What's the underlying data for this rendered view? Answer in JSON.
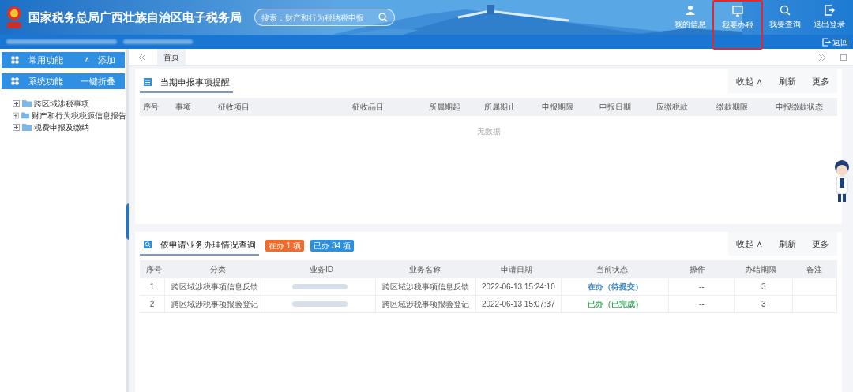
{
  "header": {
    "title": "国家税务总局广西壮族自治区电子税务局",
    "search": {
      "placeholder": "搜索：财产和行为税纳税申报"
    },
    "nav": [
      {
        "label": "我的信息",
        "selected": false
      },
      {
        "label": "我要办税",
        "selected": true
      },
      {
        "label": "我要查询",
        "selected": false
      },
      {
        "label": "退出登录",
        "selected": false
      }
    ]
  },
  "subbar": {
    "back": "返回"
  },
  "sidebar": {
    "sections": [
      {
        "title": "常用功能",
        "caret": "∧",
        "action": "添加"
      },
      {
        "title": "系统功能",
        "action": "一键折叠"
      }
    ],
    "tree": [
      {
        "label": "跨区域涉税事项",
        "expanded": false
      },
      {
        "label": "财产和行为税税源信息报告",
        "expanded": false
      },
      {
        "label": "税费申报及缴纳",
        "expanded": false
      }
    ]
  },
  "tabs": [
    {
      "label": "首页",
      "selected": true
    }
  ],
  "panels": [
    {
      "title": "当期申报事项提醒",
      "actions": [
        "收起 ∧",
        "刷新",
        "更多"
      ],
      "columns": [
        "序号",
        "事项",
        "征收项目",
        "征收品目",
        "所属期起",
        "所属期止",
        "申报期限",
        "申报日期",
        "应缴税款",
        "缴款期限",
        "申报缴款状态"
      ],
      "empty": "无数据"
    },
    {
      "title": "依申请业务办理情况查询",
      "badges": [
        {
          "label": "在办 1 项",
          "color": "#f36b2a"
        },
        {
          "label": "已办 34 项",
          "color": "#2d8fe0"
        }
      ],
      "actions": [
        "收起 ∧",
        "刷新",
        "更多"
      ],
      "columns": [
        "序号",
        "分类",
        "业务ID",
        "业务名称",
        "申请日期",
        "当前状态",
        "操作",
        "办结期限",
        "备注"
      ],
      "rows": [
        {
          "index": "1",
          "category": "跨区域涉税事项信息反馈",
          "id_blurred": true,
          "name": "跨区域涉税事项信息反馈",
          "date": "2022-06-13 15:24:10",
          "status": {
            "label": "在办（待提交）",
            "color": "#3a86c8"
          },
          "operation": "--",
          "deadline": "3"
        },
        {
          "index": "2",
          "category": "跨区域涉税事项报验登记",
          "id_blurred": true,
          "name": "跨区域涉税事项报验登记",
          "date": "2022-06-13 15:07:37",
          "status": {
            "label": "已办（已完成）",
            "color": "#3aa55a"
          },
          "operation": "--",
          "deadline": "3"
        }
      ]
    }
  ]
}
